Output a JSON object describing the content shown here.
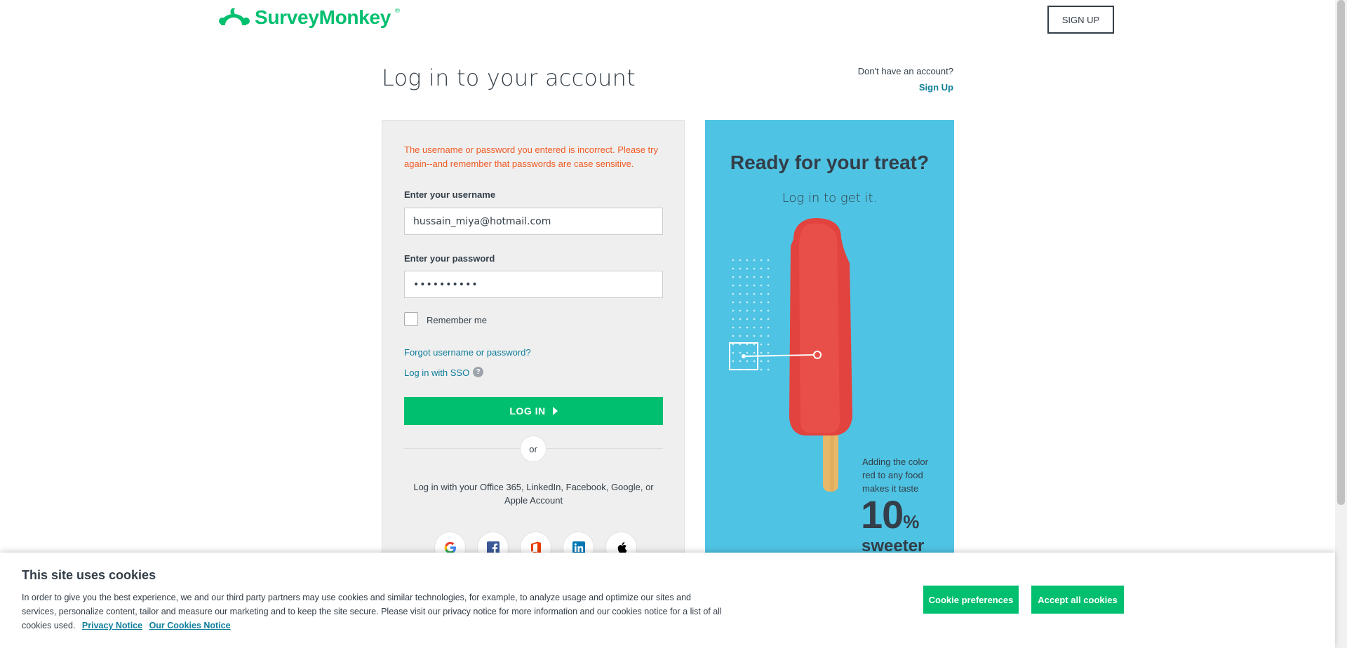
{
  "header": {
    "logo_text": "SurveyMonkey",
    "logo_reg": "®",
    "signup_label": "SIGN UP"
  },
  "page": {
    "title": "Log in to your account",
    "no_account_text": "Don't have an account?",
    "no_account_link": "Sign Up"
  },
  "login": {
    "error": "The username or password you entered is incorrect. Please try again--and remember that passwords are case sensitive.",
    "username_label": "Enter your username",
    "username_value": "hussain_miya@hotmail.com",
    "password_label": "Enter your password",
    "password_value": "••••••••••",
    "remember_label": "Remember me",
    "forgot_link": "Forgot username or password?",
    "sso_link": "Log in with SSO",
    "sso_help": "?",
    "login_button": "LOG IN",
    "or_text": "or",
    "social_text": "Log in with your Office 365, LinkedIn, Facebook, Google, or Apple Account"
  },
  "social_icons": [
    "google-icon",
    "facebook-icon",
    "office-icon",
    "linkedin-icon",
    "apple-icon"
  ],
  "promo": {
    "title": "Ready for your treat?",
    "subtitle": "Log in to get it.",
    "note": "Adding the color red to any food makes it taste",
    "number": "10",
    "percent": "%",
    "sweeter": "sweeter"
  },
  "cookies": {
    "title": "This site uses cookies",
    "body": "In order to give you the best experience, we and our third party partners may use cookies and similar technologies, for example, to analyze usage and optimize our sites and services, personalize content, tailor and measure our marketing and to keep the site secure. Please visit our privacy notice for more information and our cookies notice for a list of all cookies used.",
    "privacy_link": "Privacy Notice",
    "cookies_link": "Our Cookies Notice",
    "preferences_button": "Cookie preferences",
    "accept_button": "Accept all cookies"
  },
  "colors": {
    "brand_green": "#00bf6f",
    "link_blue": "#0f7e9b",
    "error_orange": "#f05b24",
    "promo_blue": "#4fc3e3"
  }
}
